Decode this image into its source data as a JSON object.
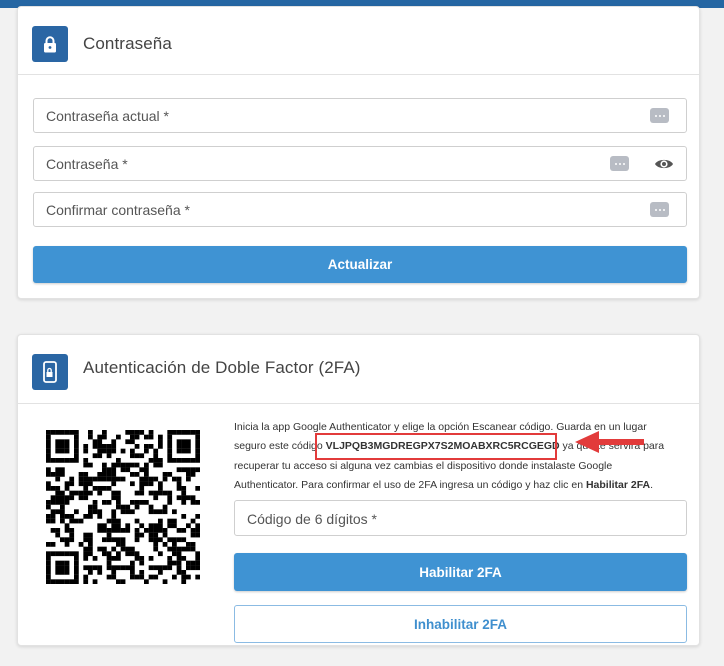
{
  "password_card": {
    "title": "Contraseña",
    "icon": "lock-icon",
    "fields": [
      {
        "label": "Contraseña actual *"
      },
      {
        "label": "Contraseña *"
      },
      {
        "label": "Confirmar contraseña *"
      }
    ],
    "update_button": "Actualizar"
  },
  "twofa_card": {
    "title": "Autenticación de Doble Factor (2FA)",
    "icon": "phone-lock-icon",
    "qr_icon": "qr-code-icon",
    "instructions_pre": "Inicia la app Google Authenticator y elige la opción Escanear código. Guarda en un lugar seguro este código ",
    "secret_code": "VLJPQB3MGDREGPX7S2MOABXRC5RCGEGD",
    "instructions_mid": " ya que te servirá para recuperar tu acceso si alguna vez cambias el dispositivo donde instalaste Google Authenticator. Para confirmar el uso de 2FA ingresa un código y haz clic en ",
    "instructions_strong": "Habilitar 2FA",
    "instructions_end": ".",
    "code_field_label": "Código de 6 dígitos *",
    "enable_button": "Habilitar 2FA",
    "disable_button": "Inhabilitar 2FA"
  },
  "colors": {
    "accent": "#3f93d3",
    "header_icon_bg": "#2a66a4",
    "highlight": "#e23b3b"
  }
}
